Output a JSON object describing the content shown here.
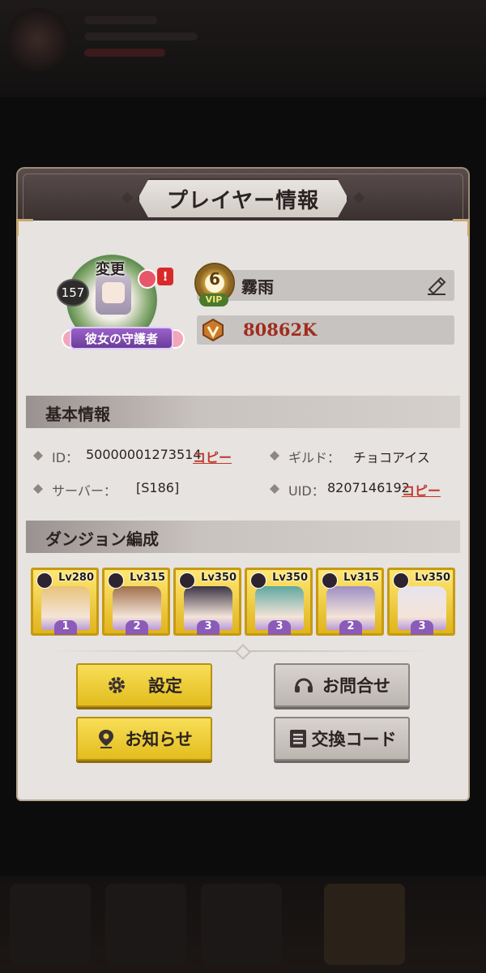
{
  "panel": {
    "title": "プレイヤー情報"
  },
  "profile": {
    "level": "157",
    "change_label": "変更",
    "alert_mark": "!",
    "title_ribbon": "彼女の守護者",
    "vip_level": "6",
    "vip_tag": "VIP",
    "player_name": "霧雨",
    "power": "80862K"
  },
  "basic_info": {
    "header": "基本情報",
    "id_label": "ID：",
    "id_value": "50000001273514",
    "guild_label": "ギルド：",
    "guild_value": "チョコアイス",
    "server_label": "サーバー：",
    "server_value": "[S186]",
    "uid_label": "UID：",
    "uid_value": "8207146192",
    "copy_label": "コピー"
  },
  "dungeon": {
    "header": "ダンジョン編成",
    "heroes": [
      {
        "level": "Lv280",
        "stars": "1",
        "color": "#e8c37a"
      },
      {
        "level": "Lv315",
        "stars": "2",
        "color": "#a0704a"
      },
      {
        "level": "Lv350",
        "stars": "3",
        "color": "#3b3446"
      },
      {
        "level": "Lv350",
        "stars": "3",
        "color": "#5fa7a0"
      },
      {
        "level": "Lv315",
        "stars": "2",
        "color": "#9e8fc4"
      },
      {
        "level": "Lv350",
        "stars": "3",
        "color": "#e7e4ee"
      }
    ]
  },
  "buttons": {
    "settings": "設定",
    "contact": "お問合せ",
    "notice": "お知らせ",
    "exchange_code": "交換コード"
  },
  "colors": {
    "accent_yellow": "#e2bd1e",
    "copy_red": "#c0392b",
    "power_red": "#a02c1c"
  }
}
